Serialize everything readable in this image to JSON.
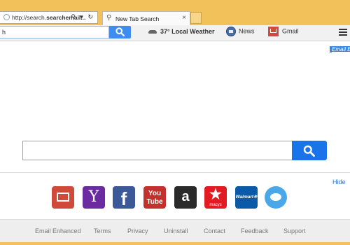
{
  "browser": {
    "address_url_prefix": "http://search.",
    "address_url_bold": "searchemail...",
    "address_icons": "⚲ ▾ ↻",
    "tab_label": "New Tab Search",
    "tab_close": "×"
  },
  "toolbar": {
    "search_value": "h",
    "weather_label": "37° Local Weather",
    "news_label": "News",
    "gmail_label": "Gmail"
  },
  "page": {
    "email_link": "Email En",
    "hide_label": "Hide"
  },
  "shortcuts": [
    {
      "name": "gmail",
      "glyph": ""
    },
    {
      "name": "yahoo",
      "glyph": "Y"
    },
    {
      "name": "facebook",
      "glyph": "f"
    },
    {
      "name": "youtube",
      "glyph": "You\nTube"
    },
    {
      "name": "amazon",
      "glyph": "a"
    },
    {
      "name": "macys",
      "glyph": "★",
      "caption": "macys"
    },
    {
      "name": "walmart",
      "glyph": "Walmart✳"
    },
    {
      "name": "twitter",
      "glyph": ""
    }
  ],
  "footer": {
    "links": [
      "Email Enhanced",
      "Terms",
      "Privacy",
      "Uninstall",
      "Contact",
      "Feedback",
      "Support"
    ]
  },
  "colors": {
    "frame": "#f2c15a",
    "accent_blue": "#1a73e8"
  }
}
